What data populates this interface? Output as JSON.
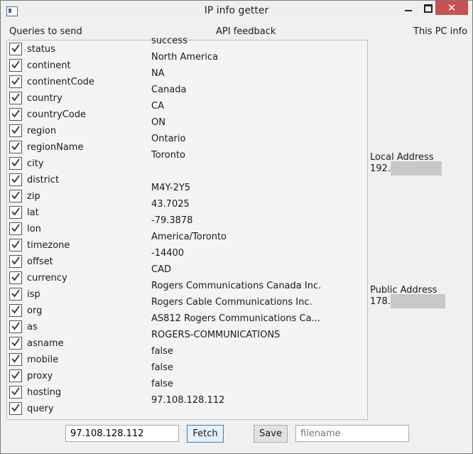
{
  "window": {
    "title": "IP info getter"
  },
  "headers": {
    "queries": "Queries to send",
    "feedback": "API feedback",
    "pc_info": "This PC info"
  },
  "rows": [
    {
      "label": "status",
      "value": "success",
      "checked": true
    },
    {
      "label": "continent",
      "value": "North America",
      "checked": true
    },
    {
      "label": "continentCode",
      "value": "NA",
      "checked": true
    },
    {
      "label": "country",
      "value": "Canada",
      "checked": true
    },
    {
      "label": "countryCode",
      "value": "CA",
      "checked": true
    },
    {
      "label": "region",
      "value": "ON",
      "checked": true
    },
    {
      "label": "regionName",
      "value": "Ontario",
      "checked": true
    },
    {
      "label": "city",
      "value": "Toronto",
      "checked": true
    },
    {
      "label": "district",
      "value": "",
      "checked": true
    },
    {
      "label": "zip",
      "value": "M4Y-2Y5",
      "checked": true
    },
    {
      "label": "lat",
      "value": "43.7025",
      "checked": true
    },
    {
      "label": "lon",
      "value": "-79.3878",
      "checked": true
    },
    {
      "label": "timezone",
      "value": "America/Toronto",
      "checked": true
    },
    {
      "label": "offset",
      "value": "-14400",
      "checked": true
    },
    {
      "label": "currency",
      "value": "CAD",
      "checked": true
    },
    {
      "label": "isp",
      "value": "Rogers Communications Canada Inc.",
      "checked": true
    },
    {
      "label": "org",
      "value": "Rogers Cable Communications Inc.",
      "checked": true
    },
    {
      "label": "as",
      "value": "AS812 Rogers Communications Ca...",
      "checked": true
    },
    {
      "label": "asname",
      "value": "ROGERS-COMMUNICATIONS",
      "checked": true
    },
    {
      "label": "mobile",
      "value": "false",
      "checked": true
    },
    {
      "label": "proxy",
      "value": "false",
      "checked": true
    },
    {
      "label": "hosting",
      "value": "false",
      "checked": true
    },
    {
      "label": "query",
      "value": "97.108.128.112",
      "checked": true
    }
  ],
  "pc_info": {
    "local_label": "Local Address",
    "local_value": "192.",
    "public_label": "Public Address",
    "public_value": "178."
  },
  "bottom": {
    "ip_value": "97.108.128.112",
    "fetch_label": "Fetch",
    "save_label": "Save",
    "filename_placeholder": "filename"
  }
}
